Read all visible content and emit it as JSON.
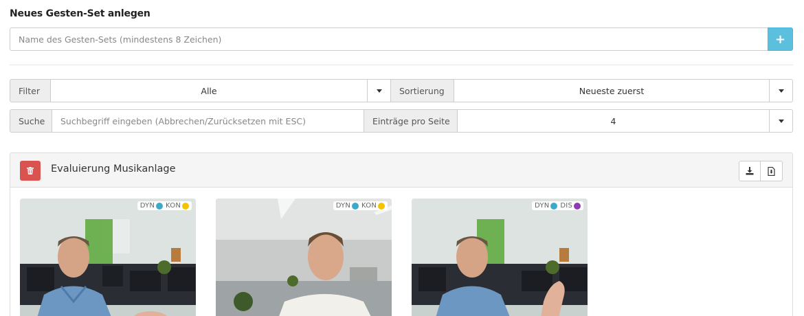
{
  "page": {
    "title": "Neues Gesten-Set anlegen",
    "name_placeholder": "Name des Gesten-Sets (mindestens 8 Zeichen)",
    "add_symbol": "+"
  },
  "filters": {
    "filter_label": "Filter",
    "filter_value": "Alle",
    "sort_label": "Sortierung",
    "sort_value": "Neueste zuerst",
    "search_label": "Suche",
    "search_placeholder": "Suchbegriff eingeben (Abbrechen/Zurücksetzen mit ESC)",
    "per_page_label": "Einträge pro Seite",
    "per_page_value": "4"
  },
  "gesture_set": {
    "title": "Evaluierung Musikanlage",
    "colors": {
      "delete": "#d9534f",
      "add": "#5bc0de"
    },
    "cards": [
      {
        "tags": [
          {
            "label": "DYN",
            "color": "#3da9c8"
          },
          {
            "label": "KON",
            "color": "#f5c400"
          }
        ]
      },
      {
        "tags": [
          {
            "label": "DYN",
            "color": "#3da9c8"
          },
          {
            "label": "KON",
            "color": "#f5c400"
          }
        ]
      },
      {
        "tags": [
          {
            "label": "DYN",
            "color": "#3da9c8"
          },
          {
            "label": "DIS",
            "color": "#8e3cb3"
          }
        ]
      }
    ]
  }
}
